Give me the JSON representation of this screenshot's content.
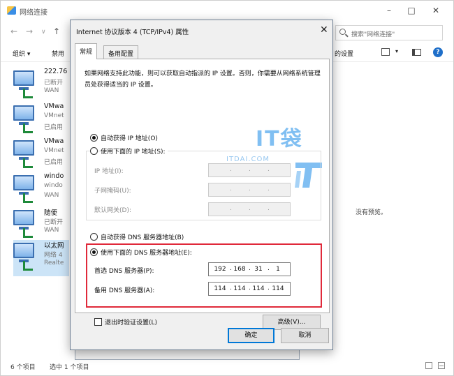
{
  "explorer": {
    "title": "网络连接",
    "search_placeholder": "搜索\"网络连接\"",
    "toolbar": {
      "organize": "组织",
      "organize_arrow": "▾",
      "disable": "禁用",
      "settings": "的设置"
    },
    "adapters": [
      {
        "line1": "222.76",
        "line2": "已断开",
        "line3": "WAN"
      },
      {
        "line1": "VMwa",
        "line2": "VMnet",
        "line3": "已启用"
      },
      {
        "line1": "VMwa",
        "line2": "VMnet",
        "line3": "已启用"
      },
      {
        "line1": "windo",
        "line2": "windo",
        "line3": "WAN"
      },
      {
        "line1": "随便",
        "line2": "已断开",
        "line3": "WAN"
      },
      {
        "line1": "以太网",
        "line2": "网络 4",
        "line3": "Realte"
      }
    ],
    "preview_text": "没有预览。",
    "status": {
      "item_count": "6 个项目",
      "selected": "选中 1 个项目"
    }
  },
  "dialog": {
    "title": "Internet 协议版本 4 (TCP/IPv4) 属性",
    "tabs": [
      "常规",
      "备用配置"
    ],
    "description": "如果网络支持此功能，则可以获取自动指派的 IP 设置。否则，你需要从网络系统管理员处获得适当的 IP 设置。",
    "ip_auto_label": "自动获得 IP 地址(O)",
    "ip_manual_label": "使用下面的 IP 地址(S):",
    "ip_fields": [
      {
        "label": "IP 地址(I):"
      },
      {
        "label": "子网掩码(U):"
      },
      {
        "label": "默认网关(D):"
      }
    ],
    "dns_auto_label": "自动获得 DNS 服务器地址(B)",
    "dns_manual_label": "使用下面的 DNS 服务器地址(E):",
    "preferred_dns": {
      "label": "首选 DNS 服务器(P):",
      "octets": [
        "192",
        "168",
        "31",
        "1"
      ]
    },
    "alternate_dns": {
      "label": "备用 DNS 服务器(A):",
      "octets": [
        "114",
        "114",
        "114",
        "114"
      ]
    },
    "validate_label": "退出时验证设置(L)",
    "advanced_button": "高级(V)...",
    "ok_button": "确定",
    "cancel_button": "取消",
    "selected": {
      "ip_mode": "auto",
      "dns_mode": "manual",
      "validate_on_exit": false
    }
  },
  "watermark": {
    "brand": "IT袋",
    "site": "ITDAI.COM"
  },
  "colors": {
    "highlight": "#e0293a",
    "accent": "#0078d7",
    "watermark": "#6bb4f0"
  }
}
